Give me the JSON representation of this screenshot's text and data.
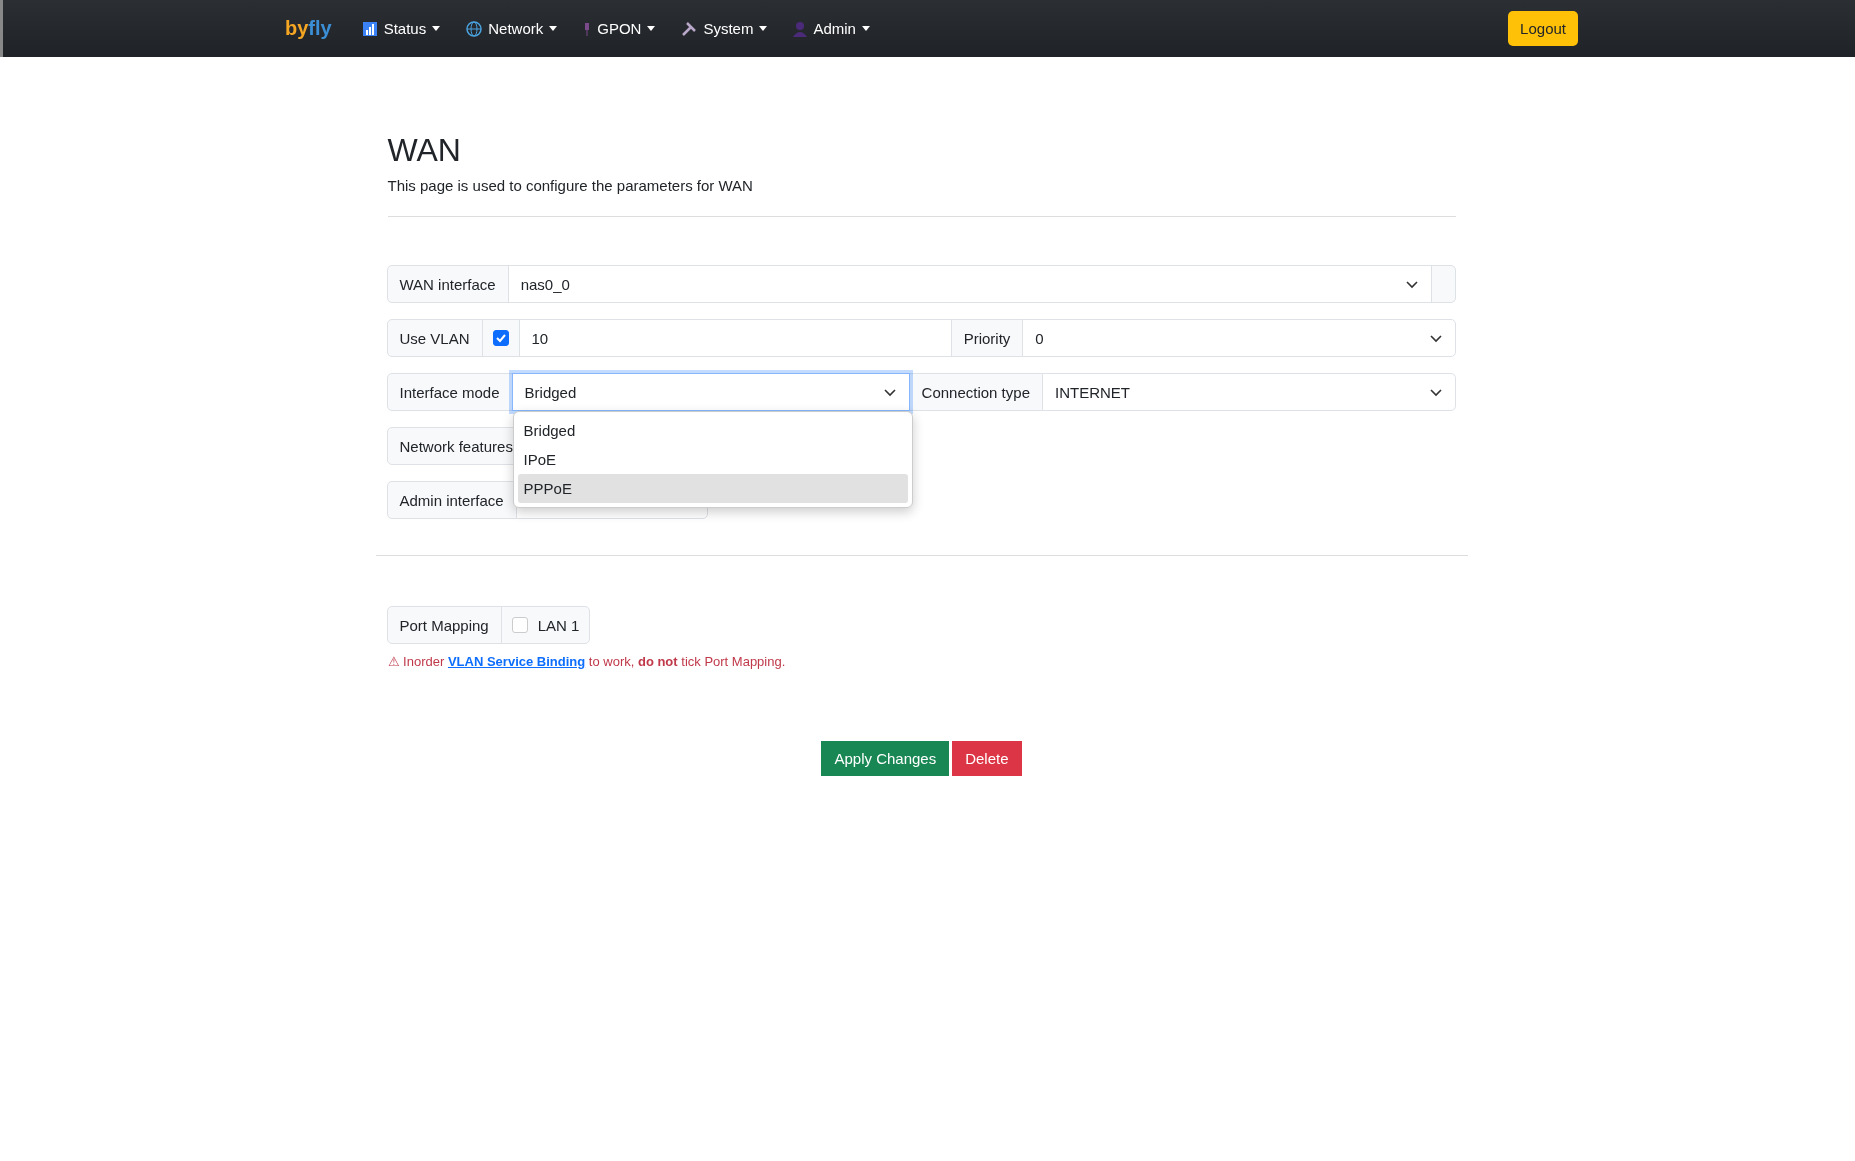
{
  "navbar": {
    "brand": [
      "by",
      "fly"
    ],
    "menu": [
      {
        "label": "Status"
      },
      {
        "label": "Network"
      },
      {
        "label": "GPON"
      },
      {
        "label": "System"
      },
      {
        "label": "Admin"
      }
    ],
    "logout": "Logout"
  },
  "page": {
    "title": "WAN",
    "subtitle": "This page is used to configure the parameters for WAN"
  },
  "wan_interface": {
    "label": "WAN interface",
    "value": "nas0_0"
  },
  "vlan": {
    "label": "Use VLAN",
    "checked": true,
    "value": "10",
    "priority_label": "Priority",
    "priority": "0"
  },
  "mode": {
    "label": "Interface mode",
    "value": "Bridged",
    "connection_label": "Connection type",
    "connection": "INTERNET",
    "options": [
      {
        "label": "Bridged",
        "highlighted": false
      },
      {
        "label": "IPoE",
        "highlighted": false
      },
      {
        "label": "PPPoE",
        "highlighted": true
      }
    ]
  },
  "network_features": {
    "label": "Network features"
  },
  "admin_interface": {
    "label": "Admin interface"
  },
  "port_mapping": {
    "label": "Port Mapping",
    "ports": [
      {
        "label": "LAN 1",
        "checked": false
      }
    ]
  },
  "warning": {
    "before": "⚠ Inorder",
    "link": "VLAN Service Binding",
    "after": "to work, **do not** tick Port Mapping."
  },
  "buttons": {
    "apply": "Apply Changes",
    "delete": "Delete"
  }
}
